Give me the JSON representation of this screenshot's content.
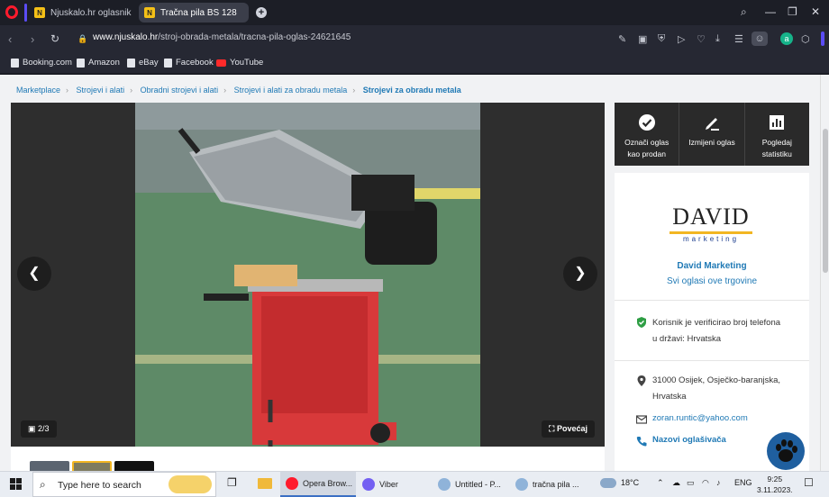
{
  "tabs": [
    {
      "label": "Njuskalo.hr oglasnik",
      "active": false
    },
    {
      "label": "Tračna pila BS 128",
      "active": true
    }
  ],
  "address": {
    "host": "www.njuskalo.hr",
    "path": "/stroj-obrada-metala/tracna-pila-oglas-24621645"
  },
  "bookmarks": [
    "Booking.com",
    "Amazon",
    "eBay",
    "Facebook",
    "YouTube"
  ],
  "breadcrumbs": [
    "Marketplace",
    "Strojevi i alati",
    "Obradni strojevi i alati",
    "Strojevi i alati za obradu metala",
    "Strojevi za obradu metala"
  ],
  "gallery": {
    "counter": "2/3",
    "zoom_label": "Povećaj"
  },
  "actions": [
    {
      "label_line1": "Označi oglas",
      "label_line2": "kao prodan",
      "icon": "check-circle-icon"
    },
    {
      "label_line1": "Izmijeni oglas",
      "label_line2": "",
      "icon": "edit-pen-icon"
    },
    {
      "label_line1": "Pogledaj",
      "label_line2": "statistiku",
      "icon": "bar-chart-icon"
    }
  ],
  "seller": {
    "logo_text": "DAVID",
    "logo_subtext": "marketing",
    "name": "David Marketing",
    "all_ads_link": "Svi oglasi ove trgovine",
    "verified_line1": "Korisnik je verificirao broj telefona",
    "verified_line2": "u državi: Hrvatska",
    "address_line1": "31000 Osijek, Osječko-baranjska,",
    "address_line2": "Hrvatska",
    "email": "zoran.runtic@yahoo.com",
    "call_label": "Nazovi oglašivača"
  },
  "taskbar": {
    "search_placeholder": "Type here to search",
    "apps": [
      "Opera Brow...",
      "Viber",
      "Untitled - P...",
      "tračna pila ..."
    ],
    "weather": "18°C",
    "lang": "ENG",
    "time": "9:25",
    "date": "3.11.2023."
  },
  "colors": {
    "link": "#1f79b5",
    "verified": "#2e9e44",
    "accent": "#5b4cf5"
  }
}
